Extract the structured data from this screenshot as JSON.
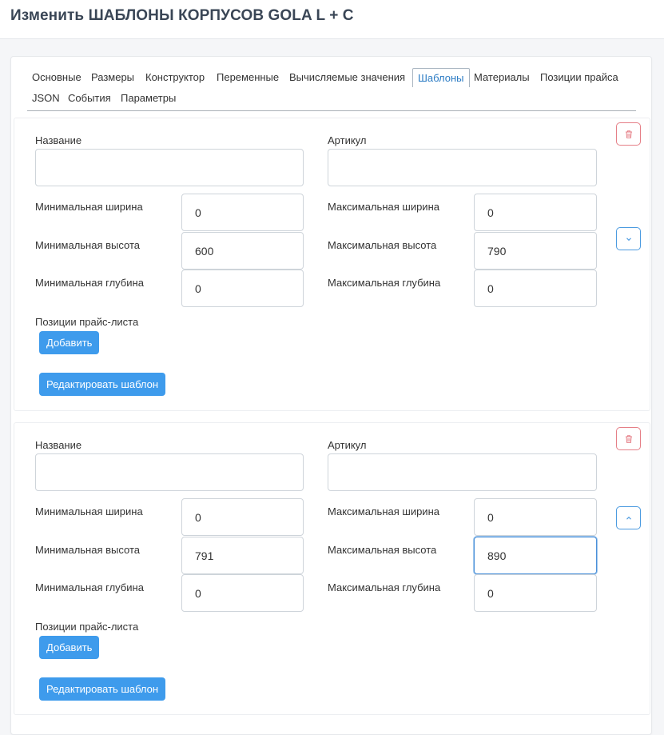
{
  "page": {
    "title": "Изменить ШАБЛОНЫ КОРПУСОВ GOLA L + C"
  },
  "tabs": [
    {
      "label": "Основные"
    },
    {
      "label": "Размеры"
    },
    {
      "label": "Конструктор"
    },
    {
      "label": "Переменные"
    },
    {
      "label": "Вычисляемые значения"
    },
    {
      "label": "Шаблоны",
      "active": true
    },
    {
      "label": "Материалы"
    },
    {
      "label": "Позиции прайса"
    },
    {
      "label": "JSON"
    },
    {
      "label": "События"
    },
    {
      "label": "Параметры"
    }
  ],
  "labels": {
    "name": "Название",
    "article": "Артикул",
    "min_width": "Минимальная ширина",
    "max_width": "Максимальная ширина",
    "min_height": "Минимальная высота",
    "max_height": "Максимальная высота",
    "min_depth": "Минимальная глубина",
    "max_depth": "Максимальная глубина",
    "price_positions": "Позиции прайс-листа",
    "add_button": "Добавить",
    "edit_button": "Редактировать шаблон"
  },
  "templates": [
    {
      "name": "",
      "article": "",
      "min_width": "0",
      "max_width": "0",
      "min_height": "600",
      "max_height": "790",
      "min_depth": "0",
      "max_depth": "0",
      "toggle_icon": "chevron-down-icon"
    },
    {
      "name": "",
      "article": "",
      "min_width": "0",
      "max_width": "0",
      "min_height": "791",
      "max_height": "890",
      "min_depth": "0",
      "max_depth": "0",
      "toggle_icon": "chevron-up-icon"
    }
  ],
  "colors": {
    "primary": "#3e9bec",
    "danger": "#e57f87",
    "active_tab": "#2b7bc4"
  },
  "icons": {
    "delete": "trash-icon"
  }
}
